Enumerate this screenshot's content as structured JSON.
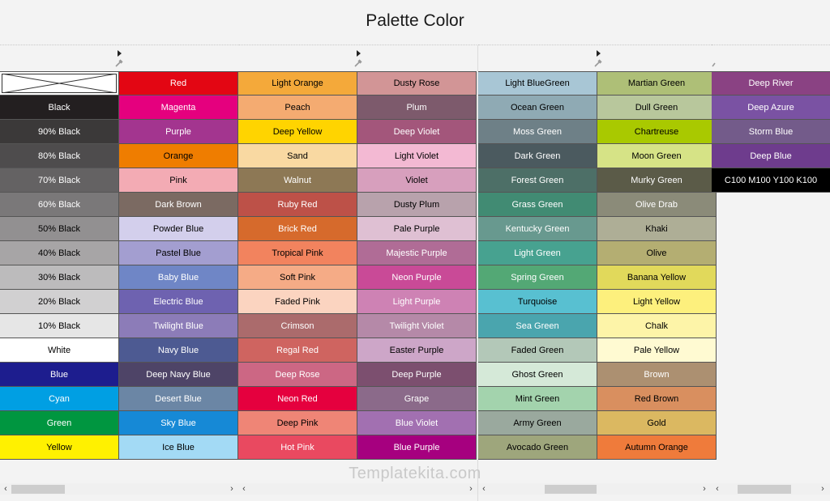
{
  "title": "Palette Color",
  "watermark": "Templatekita.com",
  "icons": {
    "expand": "triangle-right-icon",
    "picker": "eyedropper-icon",
    "no_color": "no-color-x-icon"
  },
  "panels": [
    {
      "columns": [
        [
          {
            "label": "",
            "color": "#ffffff",
            "text": "#000000",
            "none": true
          },
          {
            "label": "Black",
            "color": "#231f20",
            "text": "#ffffff"
          },
          {
            "label": "90% Black",
            "color": "#3b3939",
            "text": "#ffffff"
          },
          {
            "label": "80% Black",
            "color": "#4e4c4d",
            "text": "#ffffff"
          },
          {
            "label": "70% Black",
            "color": "#646263",
            "text": "#ffffff"
          },
          {
            "label": "60% Black",
            "color": "#7a7879",
            "text": "#ffffff"
          },
          {
            "label": "50% Black",
            "color": "#929091",
            "text": "#000000"
          },
          {
            "label": "40% Black",
            "color": "#a7a5a6",
            "text": "#000000"
          },
          {
            "label": "30% Black",
            "color": "#bcbbbc",
            "text": "#000000"
          },
          {
            "label": "20% Black",
            "color": "#d1d0d1",
            "text": "#000000"
          },
          {
            "label": "10% Black",
            "color": "#e6e6e6",
            "text": "#000000"
          },
          {
            "label": "White",
            "color": "#ffffff",
            "text": "#000000"
          },
          {
            "label": "Blue",
            "color": "#1d1d8e",
            "text": "#ffffff"
          },
          {
            "label": "Cyan",
            "color": "#009fe3",
            "text": "#ffffff"
          },
          {
            "label": "Green",
            "color": "#009640",
            "text": "#ffffff"
          },
          {
            "label": "Yellow",
            "color": "#fff100",
            "text": "#000000"
          }
        ],
        [
          {
            "label": "Red",
            "color": "#e30613",
            "text": "#ffffff"
          },
          {
            "label": "Magenta",
            "color": "#e5007e",
            "text": "#ffffff"
          },
          {
            "label": "Purple",
            "color": "#a3358f",
            "text": "#ffffff"
          },
          {
            "label": "Orange",
            "color": "#ef7d00",
            "text": "#000000"
          },
          {
            "label": "Pink",
            "color": "#f3abb4",
            "text": "#000000"
          },
          {
            "label": "Dark Brown",
            "color": "#7b6a62",
            "text": "#ffffff"
          },
          {
            "label": "Powder Blue",
            "color": "#d3cfec",
            "text": "#000000"
          },
          {
            "label": "Pastel Blue",
            "color": "#a39ed0",
            "text": "#000000"
          },
          {
            "label": "Baby Blue",
            "color": "#6f86c6",
            "text": "#ffffff"
          },
          {
            "label": "Electric Blue",
            "color": "#6e62b0",
            "text": "#ffffff"
          },
          {
            "label": "Twilight Blue",
            "color": "#8c7cb8",
            "text": "#ffffff"
          },
          {
            "label": "Navy Blue",
            "color": "#4d5a92",
            "text": "#ffffff"
          },
          {
            "label": "Deep Navy Blue",
            "color": "#4e4467",
            "text": "#ffffff"
          },
          {
            "label": "Desert Blue",
            "color": "#6b86a5",
            "text": "#ffffff"
          },
          {
            "label": "Sky Blue",
            "color": "#1689d6",
            "text": "#ffffff"
          },
          {
            "label": "Ice Blue",
            "color": "#a3daf5",
            "text": "#000000"
          }
        ]
      ]
    },
    {
      "columns": [
        [
          {
            "label": "Light Orange",
            "color": "#f4a93a",
            "text": "#000000"
          },
          {
            "label": "Peach",
            "color": "#f4ab71",
            "text": "#000000"
          },
          {
            "label": "Deep Yellow",
            "color": "#ffd400",
            "text": "#000000"
          },
          {
            "label": "Sand",
            "color": "#f9d9a2",
            "text": "#000000"
          },
          {
            "label": "Walnut",
            "color": "#8d7855",
            "text": "#ffffff"
          },
          {
            "label": "Ruby Red",
            "color": "#bd5148",
            "text": "#ffffff"
          },
          {
            "label": "Brick Red",
            "color": "#d66a2c",
            "text": "#ffffff"
          },
          {
            "label": "Tropical Pink",
            "color": "#f2835e",
            "text": "#000000"
          },
          {
            "label": "Soft Pink",
            "color": "#f5ab86",
            "text": "#000000"
          },
          {
            "label": "Faded Pink",
            "color": "#fbd4c0",
            "text": "#000000"
          },
          {
            "label": "Crimson",
            "color": "#ab6b6c",
            "text": "#ffffff"
          },
          {
            "label": "Regal Red",
            "color": "#cf6460",
            "text": "#ffffff"
          },
          {
            "label": "Deep Rose",
            "color": "#cc6784",
            "text": "#ffffff"
          },
          {
            "label": "Neon Red",
            "color": "#e5003e",
            "text": "#ffffff"
          },
          {
            "label": "Deep Pink",
            "color": "#ef8576",
            "text": "#000000"
          },
          {
            "label": "Hot Pink",
            "color": "#e94960",
            "text": "#ffffff"
          }
        ],
        [
          {
            "label": "Dusty Rose",
            "color": "#d29596",
            "text": "#000000"
          },
          {
            "label": "Plum",
            "color": "#7d5a6c",
            "text": "#ffffff"
          },
          {
            "label": "Deep Violet",
            "color": "#a3567b",
            "text": "#ffffff"
          },
          {
            "label": "Light Violet",
            "color": "#f3b9d3",
            "text": "#000000"
          },
          {
            "label": "Violet",
            "color": "#d79fbd",
            "text": "#000000"
          },
          {
            "label": "Dusty Plum",
            "color": "#b8a2ac",
            "text": "#000000"
          },
          {
            "label": "Pale Purple",
            "color": "#dfc0d3",
            "text": "#000000"
          },
          {
            "label": "Majestic Purple",
            "color": "#b06c96",
            "text": "#ffffff"
          },
          {
            "label": "Neon Purple",
            "color": "#c94a97",
            "text": "#ffffff"
          },
          {
            "label": "Light Purple",
            "color": "#ce82b4",
            "text": "#ffffff"
          },
          {
            "label": "Twilight Violet",
            "color": "#b589a8",
            "text": "#ffffff"
          },
          {
            "label": "Easter Purple",
            "color": "#cda6c8",
            "text": "#000000"
          },
          {
            "label": "Deep Purple",
            "color": "#7c4f6f",
            "text": "#ffffff"
          },
          {
            "label": "Grape",
            "color": "#8b6a8a",
            "text": "#ffffff"
          },
          {
            "label": "Blue Violet",
            "color": "#a270b1",
            "text": "#ffffff"
          },
          {
            "label": "Blue Purple",
            "color": "#a6007f",
            "text": "#ffffff"
          }
        ]
      ]
    },
    {
      "columns": [
        [
          {
            "label": "Light BlueGreen",
            "color": "#a8c6d5",
            "text": "#000000"
          },
          {
            "label": "Ocean Green",
            "color": "#8faab4",
            "text": "#000000"
          },
          {
            "label": "Moss Green",
            "color": "#6e8087",
            "text": "#ffffff"
          },
          {
            "label": "Dark Green",
            "color": "#4b5a5f",
            "text": "#ffffff"
          },
          {
            "label": "Forest Green",
            "color": "#4d6f67",
            "text": "#ffffff"
          },
          {
            "label": "Grass Green",
            "color": "#418b73",
            "text": "#ffffff"
          },
          {
            "label": "Kentucky Green",
            "color": "#68998f",
            "text": "#ffffff"
          },
          {
            "label": "Light Green",
            "color": "#47a290",
            "text": "#ffffff"
          },
          {
            "label": "Spring Green",
            "color": "#53a875",
            "text": "#ffffff"
          },
          {
            "label": "Turquoise",
            "color": "#58c0d1",
            "text": "#000000"
          },
          {
            "label": "Sea Green",
            "color": "#4aa5ae",
            "text": "#ffffff"
          },
          {
            "label": "Faded Green",
            "color": "#b3c8b8",
            "text": "#000000"
          },
          {
            "label": "Ghost Green",
            "color": "#d5e9d8",
            "text": "#000000"
          },
          {
            "label": "Mint Green",
            "color": "#a3d3ad",
            "text": "#000000"
          },
          {
            "label": "Army Green",
            "color": "#9aa99e",
            "text": "#000000"
          },
          {
            "label": "Avocado Green",
            "color": "#9ea67c",
            "text": "#000000"
          }
        ],
        [
          {
            "label": "Martian Green",
            "color": "#aebf77",
            "text": "#000000"
          },
          {
            "label": "Dull Green",
            "color": "#b8c79c",
            "text": "#000000"
          },
          {
            "label": "Chartreuse",
            "color": "#a9c900",
            "text": "#000000"
          },
          {
            "label": "Moon Green",
            "color": "#d6e386",
            "text": "#000000"
          },
          {
            "label": "Murky Green",
            "color": "#5b5b48",
            "text": "#ffffff"
          },
          {
            "label": "Olive Drab",
            "color": "#8b8b79",
            "text": "#ffffff"
          },
          {
            "label": "Khaki",
            "color": "#aeae96",
            "text": "#000000"
          },
          {
            "label": "Olive",
            "color": "#b4ae72",
            "text": "#000000"
          },
          {
            "label": "Banana Yellow",
            "color": "#e1d95b",
            "text": "#000000"
          },
          {
            "label": "Light Yellow",
            "color": "#fdf07d",
            "text": "#000000"
          },
          {
            "label": "Chalk",
            "color": "#fdf4a8",
            "text": "#000000"
          },
          {
            "label": "Pale Yellow",
            "color": "#fffad2",
            "text": "#000000"
          },
          {
            "label": "Brown",
            "color": "#ac9071",
            "text": "#ffffff"
          },
          {
            "label": "Red Brown",
            "color": "#d98f5f",
            "text": "#000000"
          },
          {
            "label": "Gold",
            "color": "#dbb861",
            "text": "#000000"
          },
          {
            "label": "Autumn Orange",
            "color": "#ef7b3b",
            "text": "#000000"
          }
        ]
      ]
    },
    {
      "columns": [
        [
          {
            "label": "Deep River",
            "color": "#8a4283",
            "text": "#ffffff"
          },
          {
            "label": "Deep Azure",
            "color": "#7a52a3",
            "text": "#ffffff"
          },
          {
            "label": "Storm Blue",
            "color": "#735b8a",
            "text": "#ffffff"
          },
          {
            "label": "Deep Blue",
            "color": "#6e3c8d",
            "text": "#ffffff"
          },
          {
            "label": "C100 M100 Y100 K100",
            "color": "#000000",
            "text": "#ffffff"
          }
        ]
      ]
    }
  ]
}
